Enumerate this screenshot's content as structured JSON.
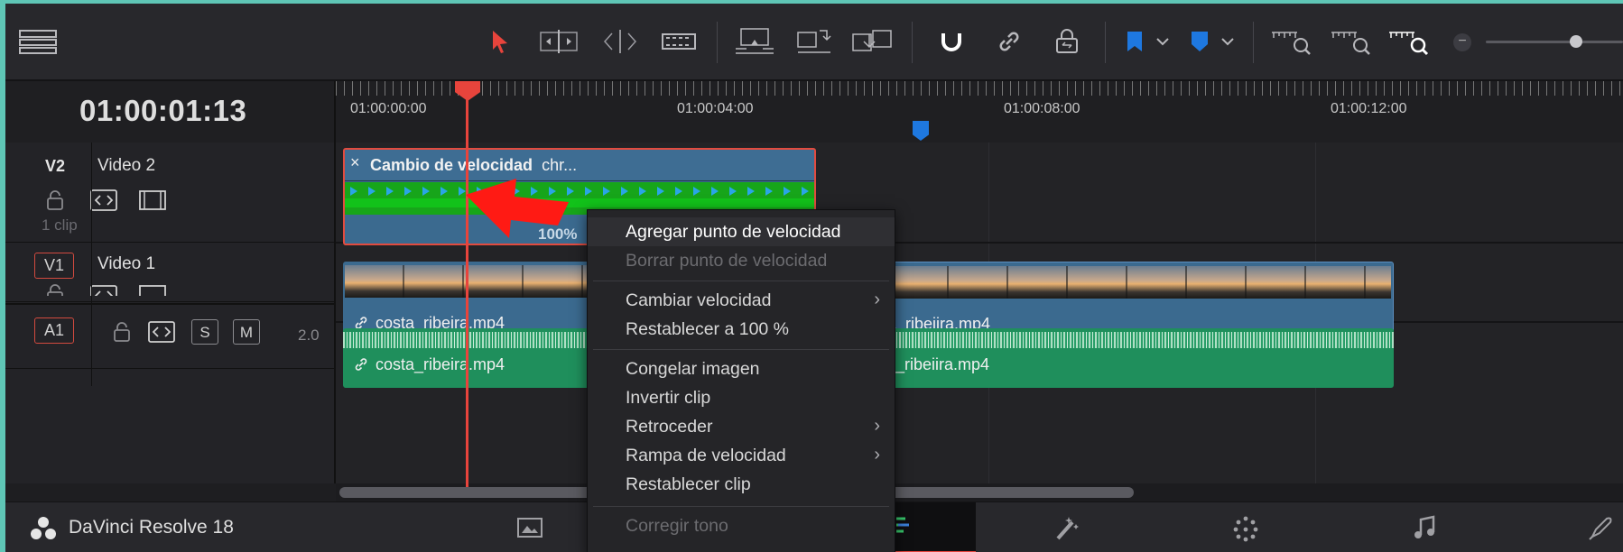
{
  "app": {
    "name": "DaVinci Resolve 18"
  },
  "timecode": "01:00:01:13",
  "ruler": {
    "labels": [
      "01:00:00:00",
      "01:00:04:00",
      "01:00:08:00",
      "01:00:12:00"
    ]
  },
  "tracks": {
    "v2": {
      "id": "V2",
      "name": "Video 2",
      "count": "1 clip"
    },
    "v1": {
      "id": "V1",
      "name": "Video 1"
    },
    "a1": {
      "id": "A1",
      "solo": "S",
      "mute": "M",
      "channels": "2.0"
    }
  },
  "clips": {
    "v2": {
      "close": "×",
      "title": "Cambio de velocidad",
      "extra": "chr...",
      "speed": "100%"
    },
    "v1_left": {
      "name": "costa_ribeira.mp4"
    },
    "v1_right": {
      "name": "a_ribeiira.mp4"
    },
    "a1_left": {
      "name": "costa_ribeira.mp4"
    },
    "a1_right": {
      "name": "a_ribeiira.mp4"
    }
  },
  "context_menu": {
    "items": [
      {
        "label": "Agregar punto de velocidad"
      },
      {
        "label": "Borrar punto de velocidad"
      },
      {
        "label": "Cambiar velocidad"
      },
      {
        "label": "Restablecer a 100 %"
      },
      {
        "label": "Congelar imagen"
      },
      {
        "label": "Invertir clip"
      },
      {
        "label": "Retroceder"
      },
      {
        "label": "Rampa de velocidad"
      },
      {
        "label": "Restablecer clip"
      },
      {
        "label": "Corregir tono"
      }
    ],
    "submenu_arrow": "›"
  },
  "colors": {
    "accent": "#e8443c",
    "marker": "#1e78e0",
    "clip_video": "#3b6a8f",
    "clip_audio": "#1f8f5c"
  }
}
